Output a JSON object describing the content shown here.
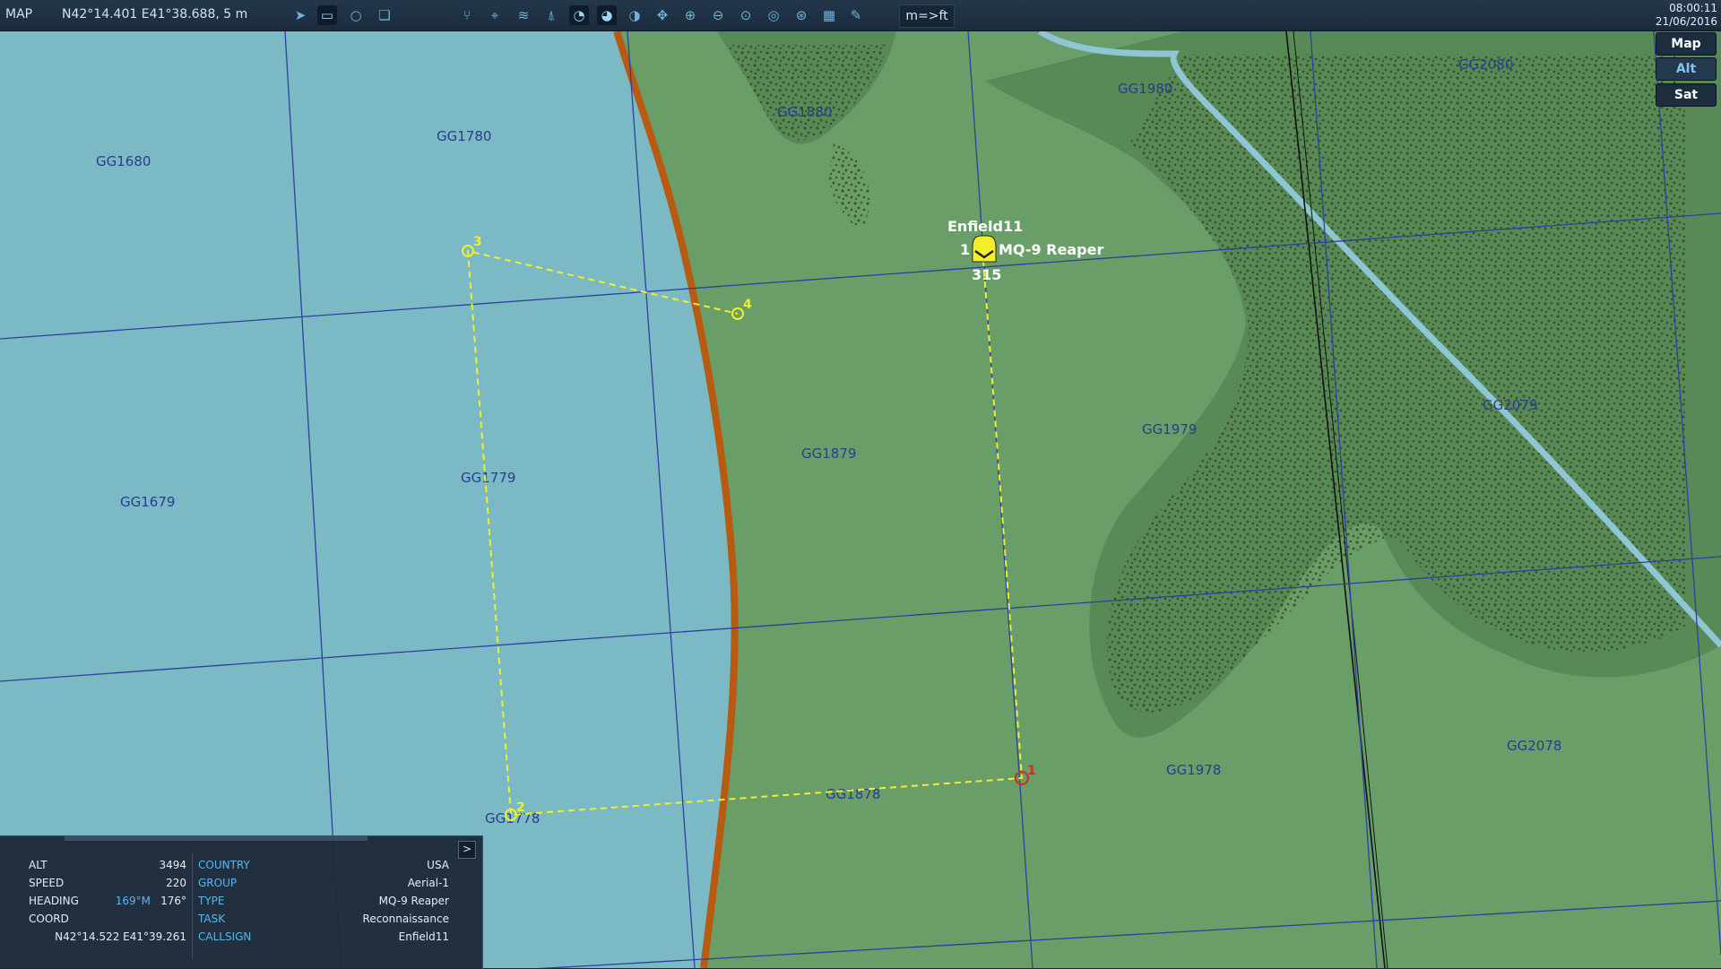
{
  "toolbar": {
    "mode_label": "MAP",
    "cursor_coords": "N42°14.401 E41°38.688, 5 m",
    "units_button": "m=>ft",
    "time": "08:00:11",
    "date": "21/06/2016",
    "icons": [
      "route-icon",
      "ruler-icon",
      "circle-icon",
      "layers-icon",
      "network-icon",
      "target-icon",
      "wifi-icon",
      "tower-icon",
      "radar-icon",
      "sam-icon",
      "ewr-icon",
      "pan-icon",
      "zoom-in-icon",
      "zoom-out-icon",
      "zoom-fit-icon",
      "target-rings-icon",
      "globe-icon",
      "grid-icon",
      "pen-icon"
    ]
  },
  "map_layers": {
    "map": "Map",
    "alt": "Alt",
    "sat": "Sat",
    "active": "Alt"
  },
  "grid_labels": [
    "GG1680",
    "GG1780",
    "GG1880",
    "GG1980",
    "GG2080",
    "GG1679",
    "GG1779",
    "GG1879",
    "GG1979",
    "GG2079",
    "GG1778",
    "GG1878",
    "GG1978",
    "GG2078"
  ],
  "unit": {
    "callsign": "Enfield11",
    "count": "1",
    "type": "MQ-9 Reaper",
    "heading_value": "315"
  },
  "waypoints": [
    "1",
    "2",
    "3",
    "4"
  ],
  "colors": {
    "sea": "#7bbac4",
    "land": "#699e68",
    "forest": "#578a56",
    "river": "#8fc6d6",
    "coast": "#b85a10",
    "grid": "#2f3fa0",
    "route": "#f3ee2b",
    "waypoint_start": "#d22a24"
  },
  "info_panel": {
    "toggle": ">",
    "alt_label": "ALT",
    "alt_value": "3494",
    "speed_label": "SPEED",
    "speed_value": "220",
    "heading_label": "HEADING",
    "heading_mag": "169°M",
    "heading_true": "176°",
    "coord_label": "COORD",
    "coord_value": "N42°14.522 E41°39.261",
    "country_label": "COUNTRY",
    "country_value": "USA",
    "group_label": "GROUP",
    "group_value": "Aerial-1",
    "type_label": "TYPE",
    "type_value": "MQ-9 Reaper",
    "task_label": "TASK",
    "task_value": "Reconnaissance",
    "callsign_label": "CALLSIGN",
    "callsign_value": "Enfield11"
  }
}
